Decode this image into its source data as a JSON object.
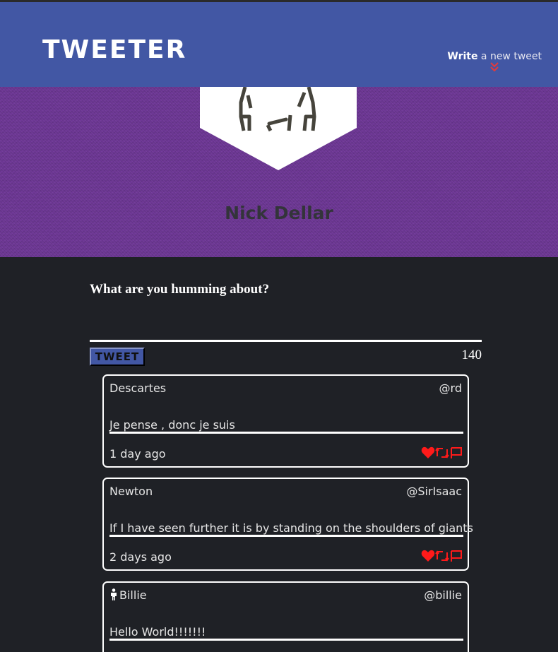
{
  "nav": {
    "brand": "TWEETER",
    "compose_bold": "Write",
    "compose_rest": " a new tweet"
  },
  "profile": {
    "name": "Nick Dellar"
  },
  "composer": {
    "question": "What are you humming about?",
    "button_label": "TWEET",
    "counter": "140"
  },
  "tweets": [
    {
      "name": "Descartes",
      "handle": "@rd",
      "text": "Je pense , donc je suis",
      "time": "1 day ago"
    },
    {
      "name": "Newton",
      "handle": "@SirIsaac",
      "text": "If I have seen further it is by standing on the shoulders of giants",
      "time": "2 days ago"
    },
    {
      "name": "Billie",
      "handle": "@billie",
      "text": "Hello World!!!!!!!",
      "time": ""
    }
  ],
  "colors": {
    "nav": "#4257a4",
    "hero": "#6e3796",
    "background": "#1f2126",
    "action_icons": "#ff1a1a"
  },
  "icons": [
    "double-chevron-down-icon",
    "avatar-icon",
    "heart-icon",
    "retweet-icon",
    "flag-icon",
    "person-icon"
  ]
}
